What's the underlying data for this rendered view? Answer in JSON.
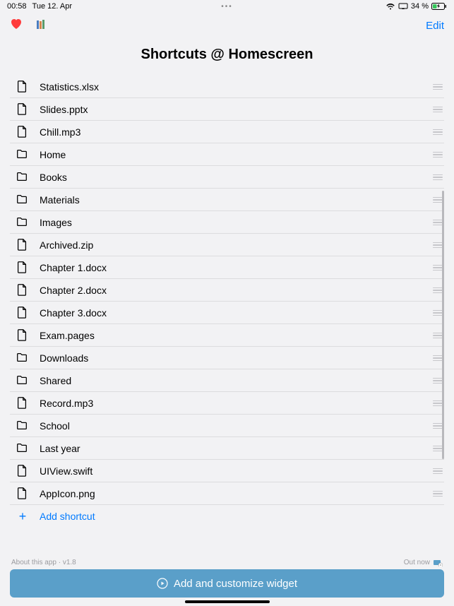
{
  "status_bar": {
    "time": "00:58",
    "date": "Tue 12. Apr",
    "battery_pct": "34 %"
  },
  "nav": {
    "edit_label": "Edit"
  },
  "title": "Shortcuts @ Homescreen",
  "items": [
    {
      "type": "file",
      "name": "Statistics.xlsx"
    },
    {
      "type": "file",
      "name": "Slides.pptx"
    },
    {
      "type": "file",
      "name": "Chill.mp3"
    },
    {
      "type": "folder",
      "name": "Home"
    },
    {
      "type": "folder",
      "name": "Books"
    },
    {
      "type": "folder",
      "name": "Materials"
    },
    {
      "type": "folder",
      "name": "Images"
    },
    {
      "type": "file",
      "name": "Archived.zip"
    },
    {
      "type": "file",
      "name": "Chapter 1.docx"
    },
    {
      "type": "file",
      "name": "Chapter 2.docx"
    },
    {
      "type": "file",
      "name": "Chapter 3.docx"
    },
    {
      "type": "file",
      "name": "Exam.pages"
    },
    {
      "type": "folder",
      "name": "Downloads"
    },
    {
      "type": "folder",
      "name": "Shared"
    },
    {
      "type": "file",
      "name": "Record.mp3"
    },
    {
      "type": "folder",
      "name": "School"
    },
    {
      "type": "folder",
      "name": "Last year"
    },
    {
      "type": "file",
      "name": "UIView.swift"
    },
    {
      "type": "file",
      "name": "AppIcon.png"
    }
  ],
  "add_shortcut_label": "Add shortcut",
  "footer": {
    "about": "About this app · v1.8",
    "out_now": "Out now",
    "widget_btn": "Add and customize widget"
  }
}
